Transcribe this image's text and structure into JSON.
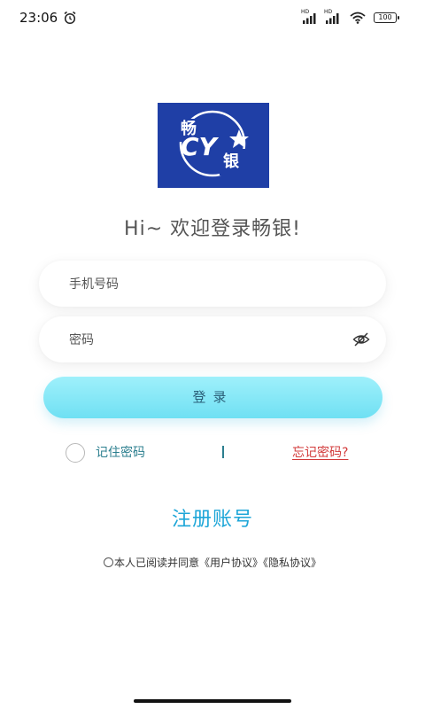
{
  "status_bar": {
    "time": "23:06",
    "network_1": "HD",
    "network_2": "HD",
    "battery": "100"
  },
  "logo": {
    "text_main": "CY",
    "text_top": "畅",
    "text_bottom": "银",
    "bg_color": "#1f3fa6"
  },
  "welcome_text": "Hi~ 欢迎登录畅银!",
  "phone_input": {
    "placeholder": "手机号码",
    "value": ""
  },
  "password_input": {
    "placeholder": "密码",
    "value": ""
  },
  "login_button": "登录",
  "remember_label": "记住密码",
  "divider_text": "|",
  "forgot_password": "忘记密码?",
  "register_link": "注册账号",
  "agreement": {
    "prefix": "本人已阅读并同意",
    "user_agreement": "《用户协议》",
    "privacy_agreement": "《隐私协议》"
  },
  "colors": {
    "accent": "#1ea6d8",
    "button": "#7ce6f6",
    "link_red": "#d23a3a",
    "teal_text": "#2c7f8f"
  }
}
